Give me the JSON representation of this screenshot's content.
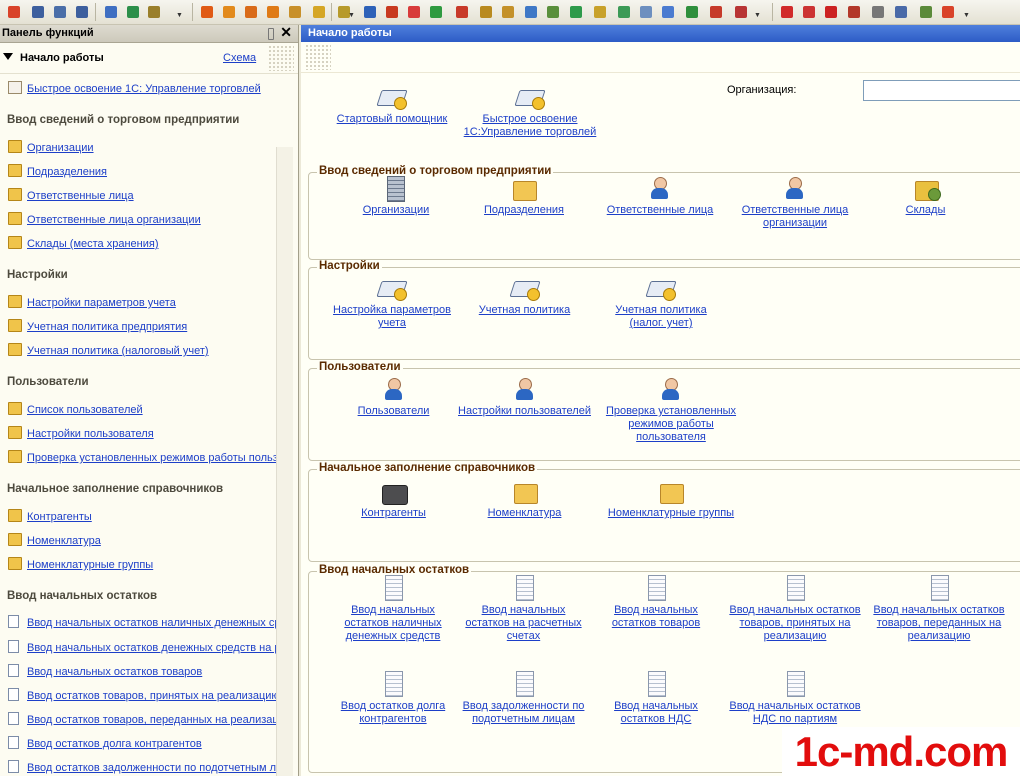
{
  "left_panel": {
    "title": "Панель функций",
    "close": "✕",
    "header_title": "Начало работы",
    "schema_link": "Схема",
    "quick_link": "Быстрое освоение 1С: Управление торговлей",
    "sections": [
      {
        "title": "Ввод сведений о торговом предприятии",
        "items": [
          "Организации",
          "Подразделения",
          "Ответственные лица",
          "Ответственные лица организации",
          "Склады (места хранения)"
        ]
      },
      {
        "title": "Настройки",
        "items": [
          "Настройки параметров учета",
          "Учетная политика предприятия",
          "Учетная политика (налоговый учет)"
        ]
      },
      {
        "title": "Пользователи",
        "items": [
          "Список пользователей",
          "Настройки пользователя",
          "Проверка установленных режимов работы польз"
        ]
      },
      {
        "title": "Начальное заполнение справочников",
        "items": [
          "Контрагенты",
          "Номенклатура",
          "Номенклатурные группы"
        ]
      },
      {
        "title": "Ввод начальных остатков",
        "items": [
          "Ввод начальных остатков наличных денежных ср",
          "Ввод начальных остатков денежных средств на р",
          "Ввод начальных остатков товаров",
          "Ввод остатков товаров, принятых на реализацию",
          "Ввод остатков товаров, переданных на реализац",
          "Ввод остатков долга контрагентов",
          "Ввод остатков задолженности по подотчетным л"
        ]
      }
    ]
  },
  "main": {
    "title": "Начало работы",
    "org_label": "Организация:",
    "org_value": "",
    "top_items": [
      "Стартовый помощник",
      "Быстрое освоение\n1С:Управление торговлей"
    ],
    "groups": [
      {
        "title": "Ввод сведений о торговом предприятии",
        "items": [
          "Организации",
          "Подразделения",
          "Ответственные лица",
          "Ответственные лица\nорганизации",
          "Склады"
        ]
      },
      {
        "title": "Настройки",
        "items": [
          "Настройка параметров\nучета",
          "Учетная политика",
          "Учетная политика\n(налог. учет)"
        ]
      },
      {
        "title": "Пользователи",
        "items": [
          "Пользователи",
          "Настройки пользователей",
          "Проверка установленных\nрежимов работы\nпользователя"
        ]
      },
      {
        "title": "Начальное заполнение справочников",
        "items": [
          "Контрагенты",
          "Номенклатура",
          "Номенклатурные группы"
        ]
      },
      {
        "title": "Ввод начальных остатков",
        "items": [
          "Ввод начальных\nостатков наличных\nденежных средств",
          "Ввод начальных\nостатков на расчетных\nсчетах",
          "Ввод начальных\nостатков товаров",
          "Ввод начальных остатков\nтоваров, принятых на\nреализацию",
          "Ввод начальных остатков\nтоваров, переданных на\nреализацию",
          "Ввод остатков долга\nконтрагентов",
          "Ввод задолженности по\nподотчетным лицам",
          "Ввод начальных\nостатков НДС",
          "Ввод начальных остатков\nНДС по партиям"
        ]
      }
    ]
  },
  "watermark": "1c-md.com",
  "colors": {
    "link": "#1d3fc8",
    "title_bar": "#2d5cc6",
    "group_title": "#5a2a00",
    "watermark": "#e20d0d"
  }
}
